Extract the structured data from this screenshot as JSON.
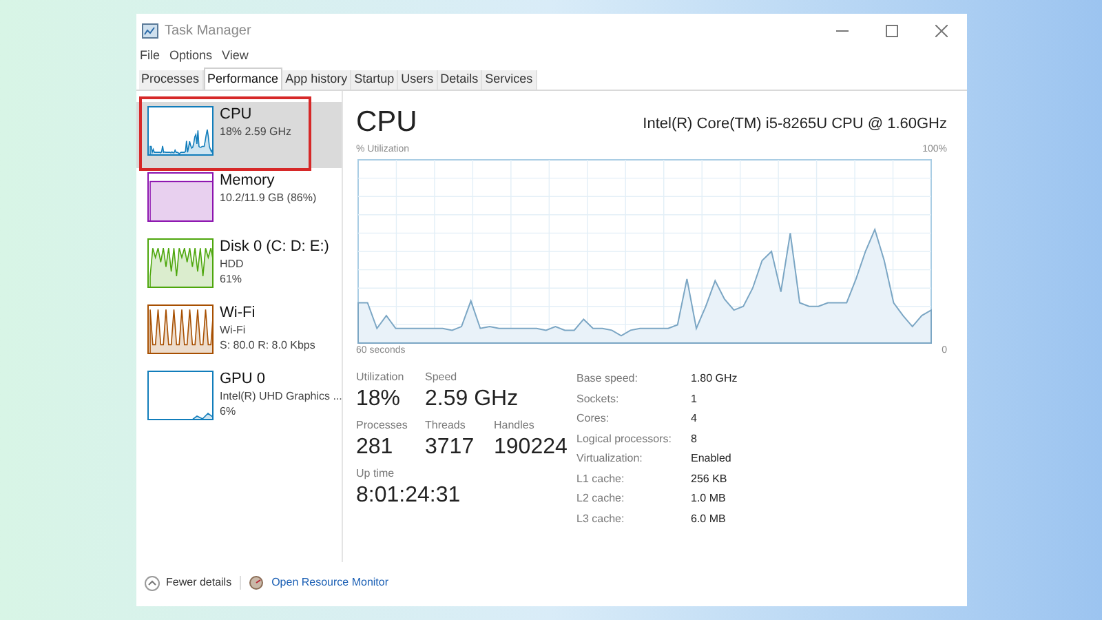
{
  "window": {
    "title": "Task Manager"
  },
  "menu": [
    "File",
    "Options",
    "View"
  ],
  "tabs": [
    {
      "label": "Processes",
      "selected": false
    },
    {
      "label": "Performance",
      "selected": true
    },
    {
      "label": "App history",
      "selected": false
    },
    {
      "label": "Startup",
      "selected": false
    },
    {
      "label": "Users",
      "selected": false
    },
    {
      "label": "Details",
      "selected": false
    },
    {
      "label": "Services",
      "selected": false
    }
  ],
  "sidebar": {
    "items": [
      {
        "name": "CPU",
        "lines": [
          "18% 2.59 GHz"
        ],
        "selected": true,
        "color": "#117dbb"
      },
      {
        "name": "Memory",
        "lines": [
          "10.2/11.9 GB (86%)"
        ],
        "selected": false,
        "color": "#8b12ae"
      },
      {
        "name": "Disk 0 (C: D: E:)",
        "lines": [
          "HDD",
          "61%"
        ],
        "selected": false,
        "color": "#4da60c"
      },
      {
        "name": "Wi-Fi",
        "lines": [
          "Wi-Fi",
          "S: 80.0 R: 8.0 Kbps"
        ],
        "selected": false,
        "color": "#a74f01"
      },
      {
        "name": "GPU 0",
        "lines": [
          "Intel(R) UHD Graphics ...",
          "6%"
        ],
        "selected": false,
        "color": "#117dbb"
      }
    ]
  },
  "main": {
    "title": "CPU",
    "model": "Intel(R) Core(TM) i5-8265U CPU @ 1.60GHz",
    "graph_label": "% Utilization",
    "graph_max": "100%",
    "graph_span": "60 seconds",
    "graph_min": "0",
    "stats": [
      [
        {
          "label": "Utilization",
          "value": "18%"
        },
        {
          "label": "Speed",
          "value": "2.59 GHz"
        }
      ],
      [
        {
          "label": "Processes",
          "value": "281"
        },
        {
          "label": "Threads",
          "value": "3717"
        },
        {
          "label": "Handles",
          "value": "190224"
        }
      ],
      [
        {
          "label": "Up time",
          "value": "8:01:24:31"
        }
      ]
    ],
    "details": [
      {
        "key": "Base speed:",
        "value": "1.80 GHz"
      },
      {
        "key": "Sockets:",
        "value": "1"
      },
      {
        "key": "Cores:",
        "value": "4"
      },
      {
        "key": "Logical processors:",
        "value": "8"
      },
      {
        "key": "Virtualization:",
        "value": "Enabled"
      },
      {
        "key": "L1 cache:",
        "value": "256 KB"
      },
      {
        "key": "L2 cache:",
        "value": "1.0 MB"
      },
      {
        "key": "L3 cache:",
        "value": "6.0 MB"
      }
    ]
  },
  "footer": {
    "fewer": "Fewer details",
    "monitor": "Open Resource Monitor"
  }
}
